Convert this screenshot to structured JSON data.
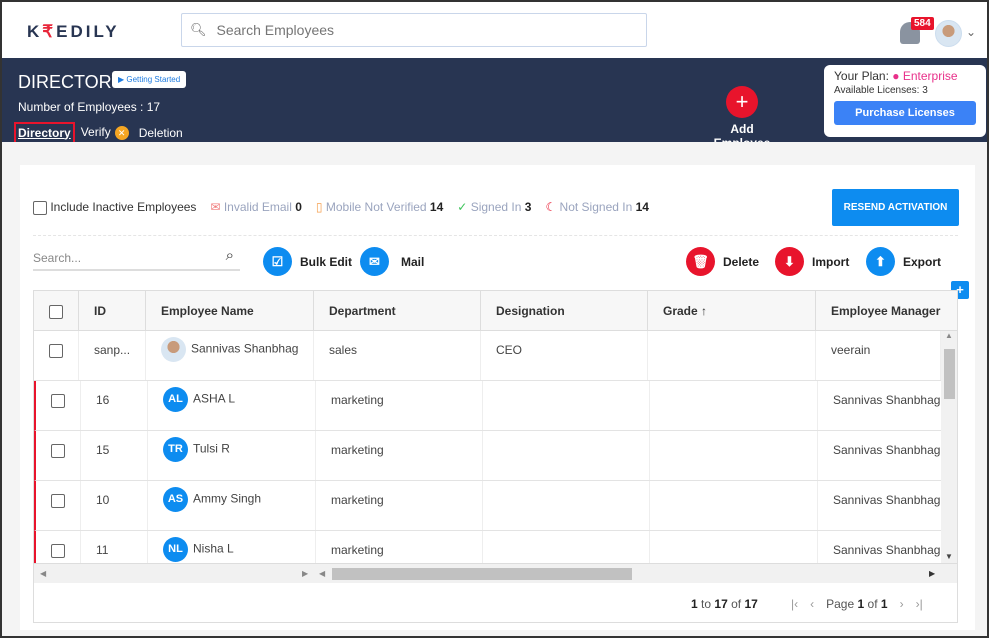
{
  "topbar": {
    "logo": "KREDILY",
    "search_placeholder": "Search Employees",
    "notifications": "584"
  },
  "header": {
    "title": "DIRECTORY",
    "getting_started": "Getting Started",
    "employee_count_label": "Number of Employees : 17",
    "tabs": [
      {
        "label": "Directory"
      },
      {
        "label": "Verify"
      },
      {
        "label": "Deletion"
      }
    ],
    "add_employee": "Add Employee"
  },
  "plan": {
    "label": "Your Plan:",
    "name": "Enterprise",
    "licenses": "Available Licenses: 3",
    "purchase": "Purchase Licenses"
  },
  "stats": {
    "include_inactive": "Include Inactive Employees",
    "invalid_email": "Invalid Email",
    "invalid_email_count": "0",
    "mobile_not_verified": "Mobile Not Verified",
    "mobile_not_verified_count": "14",
    "signed_in": "Signed In",
    "signed_in_count": "3",
    "not_signed_in": "Not Signed In",
    "not_signed_in_count": "14",
    "resend": "RESEND ACTIVATION"
  },
  "toolbar": {
    "search_placeholder": "Search...",
    "bulk_edit": "Bulk Edit",
    "mail": "Mail",
    "delete": "Delete",
    "import": "Import",
    "export": "Export"
  },
  "table": {
    "columns": [
      "ID",
      "Employee Name",
      "Department",
      "Designation",
      "Grade",
      "Employee Manager"
    ],
    "sort_indicator": "↑",
    "rows": [
      {
        "id": "sanp...",
        "initials": "",
        "name": "Sannivas Shanbhag",
        "department": "sales",
        "designation": "CEO",
        "grade": "",
        "manager": "veerain"
      },
      {
        "id": "16",
        "initials": "AL",
        "name": "ASHA L",
        "department": "marketing",
        "designation": "",
        "grade": "",
        "manager": "Sannivas Shanbhag"
      },
      {
        "id": "15",
        "initials": "TR",
        "name": "Tulsi R",
        "department": "marketing",
        "designation": "",
        "grade": "",
        "manager": "Sannivas Shanbhag"
      },
      {
        "id": "10",
        "initials": "AS",
        "name": "Ammy Singh",
        "department": "marketing",
        "designation": "",
        "grade": "",
        "manager": "Sannivas Shanbhag"
      },
      {
        "id": "11",
        "initials": "NL",
        "name": "Nisha L",
        "department": "marketing",
        "designation": "",
        "grade": "",
        "manager": "Sannivas Shanbhag"
      }
    ]
  },
  "pagination": {
    "from": "1",
    "to_label": "to",
    "to": "17",
    "of_label": "of",
    "total": "17",
    "page_label": "Page",
    "page": "1",
    "page_of": "of",
    "pages": "1"
  }
}
